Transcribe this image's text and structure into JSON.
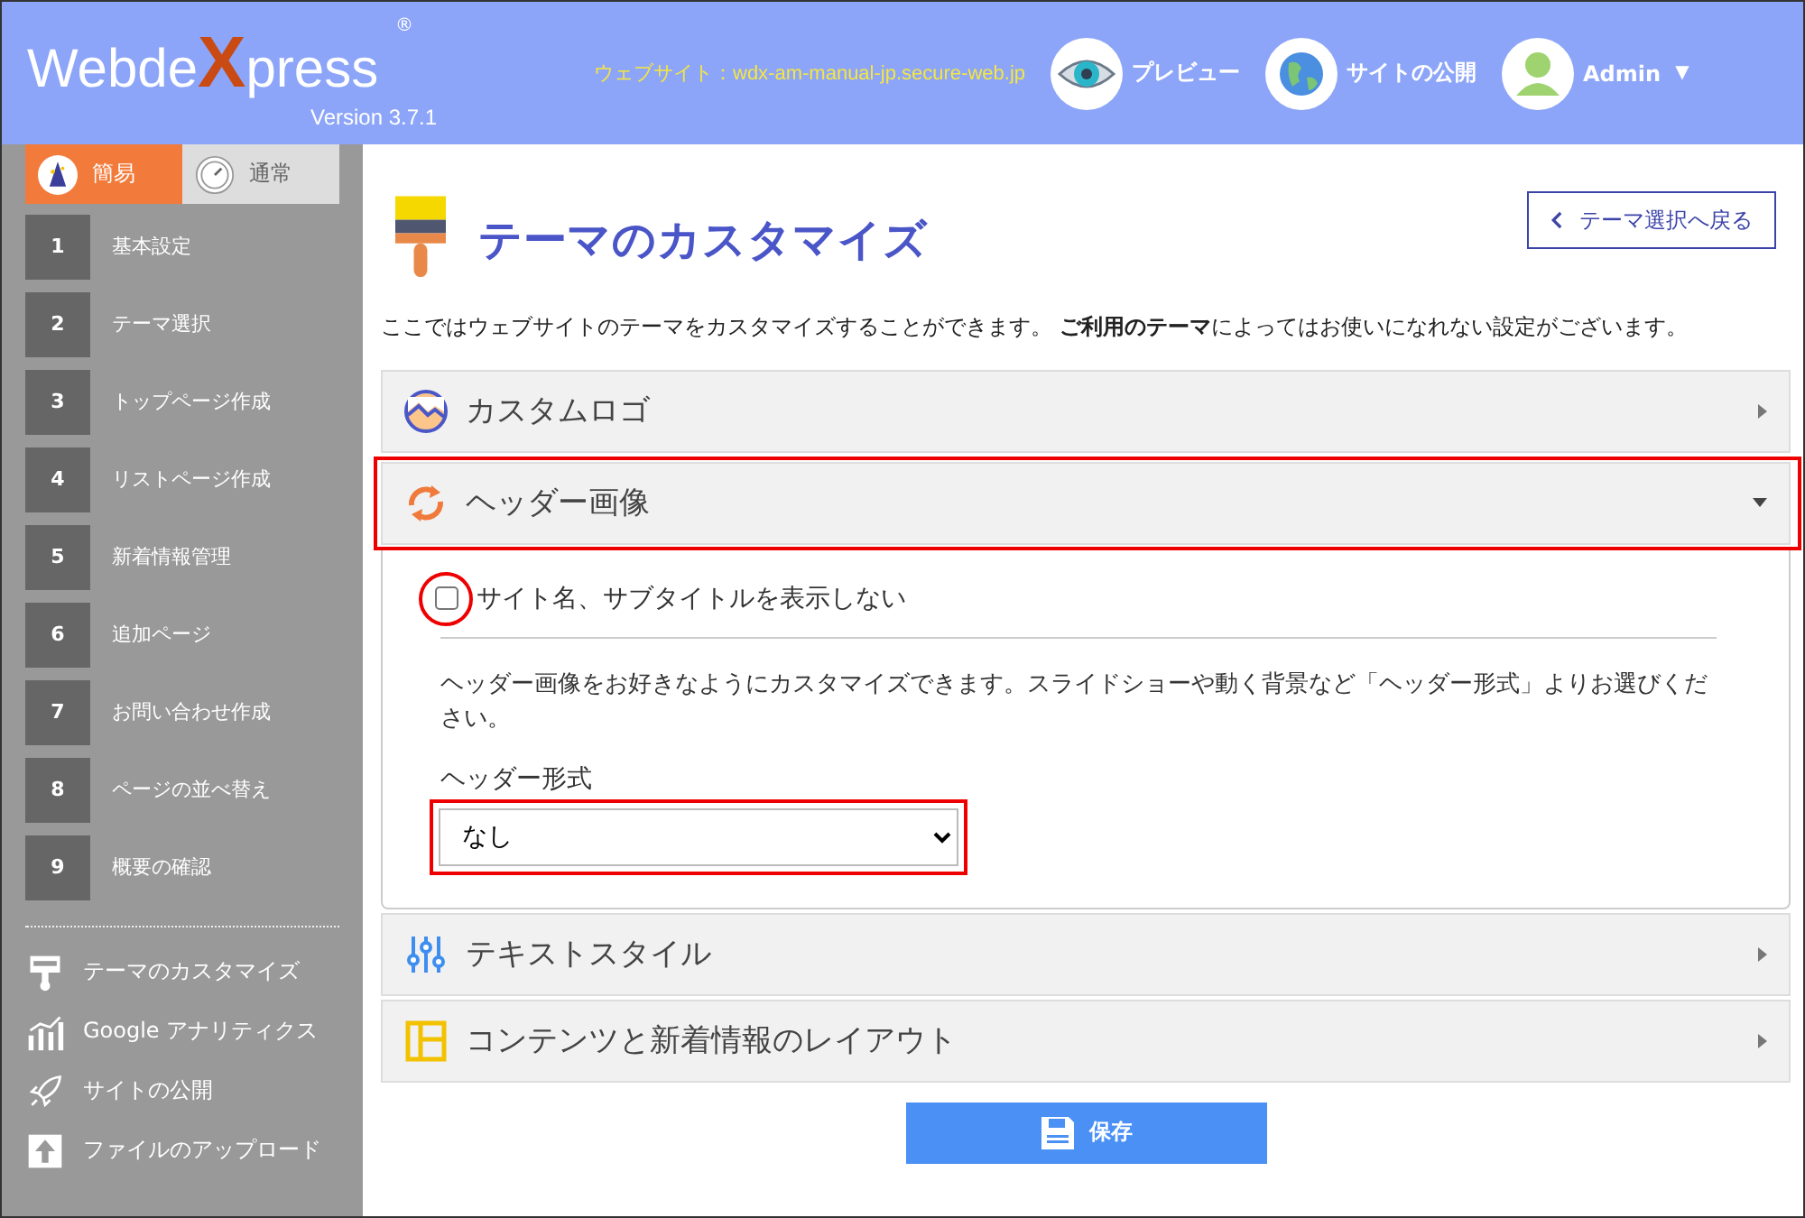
{
  "header": {
    "logo": {
      "before": "Webde",
      "mark": "X",
      "after": "press",
      "registered": "®",
      "version": "Version 3.7.1"
    },
    "website_url": "ウェブサイト：wdx-am-manual-jp.secure-web.jp",
    "actions": [
      {
        "label": "プレビュー"
      },
      {
        "label": "サイトの公開"
      }
    ],
    "user": {
      "name": "Admin",
      "caret": "▼"
    }
  },
  "sidebar": {
    "modes": [
      {
        "label": "簡易",
        "selected": true
      },
      {
        "label": "通常",
        "selected": false
      }
    ],
    "steps": [
      {
        "number": "1",
        "label": "基本設定"
      },
      {
        "number": "2",
        "label": "テーマ選択"
      },
      {
        "number": "3",
        "label": "トップページ作成"
      },
      {
        "number": "4",
        "label": "リストページ作成"
      },
      {
        "number": "5",
        "label": "新着情報管理"
      },
      {
        "number": "6",
        "label": "追加ページ"
      },
      {
        "number": "7",
        "label": "お問い合わせ作成"
      },
      {
        "number": "8",
        "label": "ページの並べ替え"
      },
      {
        "number": "9",
        "label": "概要の確認"
      }
    ],
    "tools": [
      {
        "label": "テーマのカスタマイズ"
      },
      {
        "label": "Google アナリティクス"
      },
      {
        "label": "サイトの公開"
      },
      {
        "label": "ファイルのアップロード"
      }
    ]
  },
  "main": {
    "title": "テーマのカスタマイズ",
    "back_button": "テーマ選択へ戻る",
    "description": "ここではウェブサイトのテーマをカスタマイズすることができます。 **ご利用のテーマ**によってはお使いになれない設定がございます。",
    "sections": [
      {
        "label": "カスタムロゴ",
        "expanded": false,
        "highlighted": false
      },
      {
        "label": "ヘッダー画像",
        "expanded": true,
        "highlighted": true
      },
      {
        "label": "テキストスタイル",
        "expanded": false,
        "highlighted": false
      },
      {
        "label": "コンテンツと新着情報のレイアウト",
        "expanded": false,
        "highlighted": false
      }
    ],
    "header_panel": {
      "hide_title": {
        "label": "サイト名、サブタイトルを表示しない",
        "checked": false,
        "highlighted": true
      },
      "help": "ヘッダー画像をお好きなようにカスタマイズできます。スライドショーや動く背景など「ヘッダー形式」よりお選びください。",
      "format_label": "ヘッダー形式",
      "format": {
        "value": "なし",
        "highlighted": true
      }
    },
    "save_button": "保存"
  }
}
